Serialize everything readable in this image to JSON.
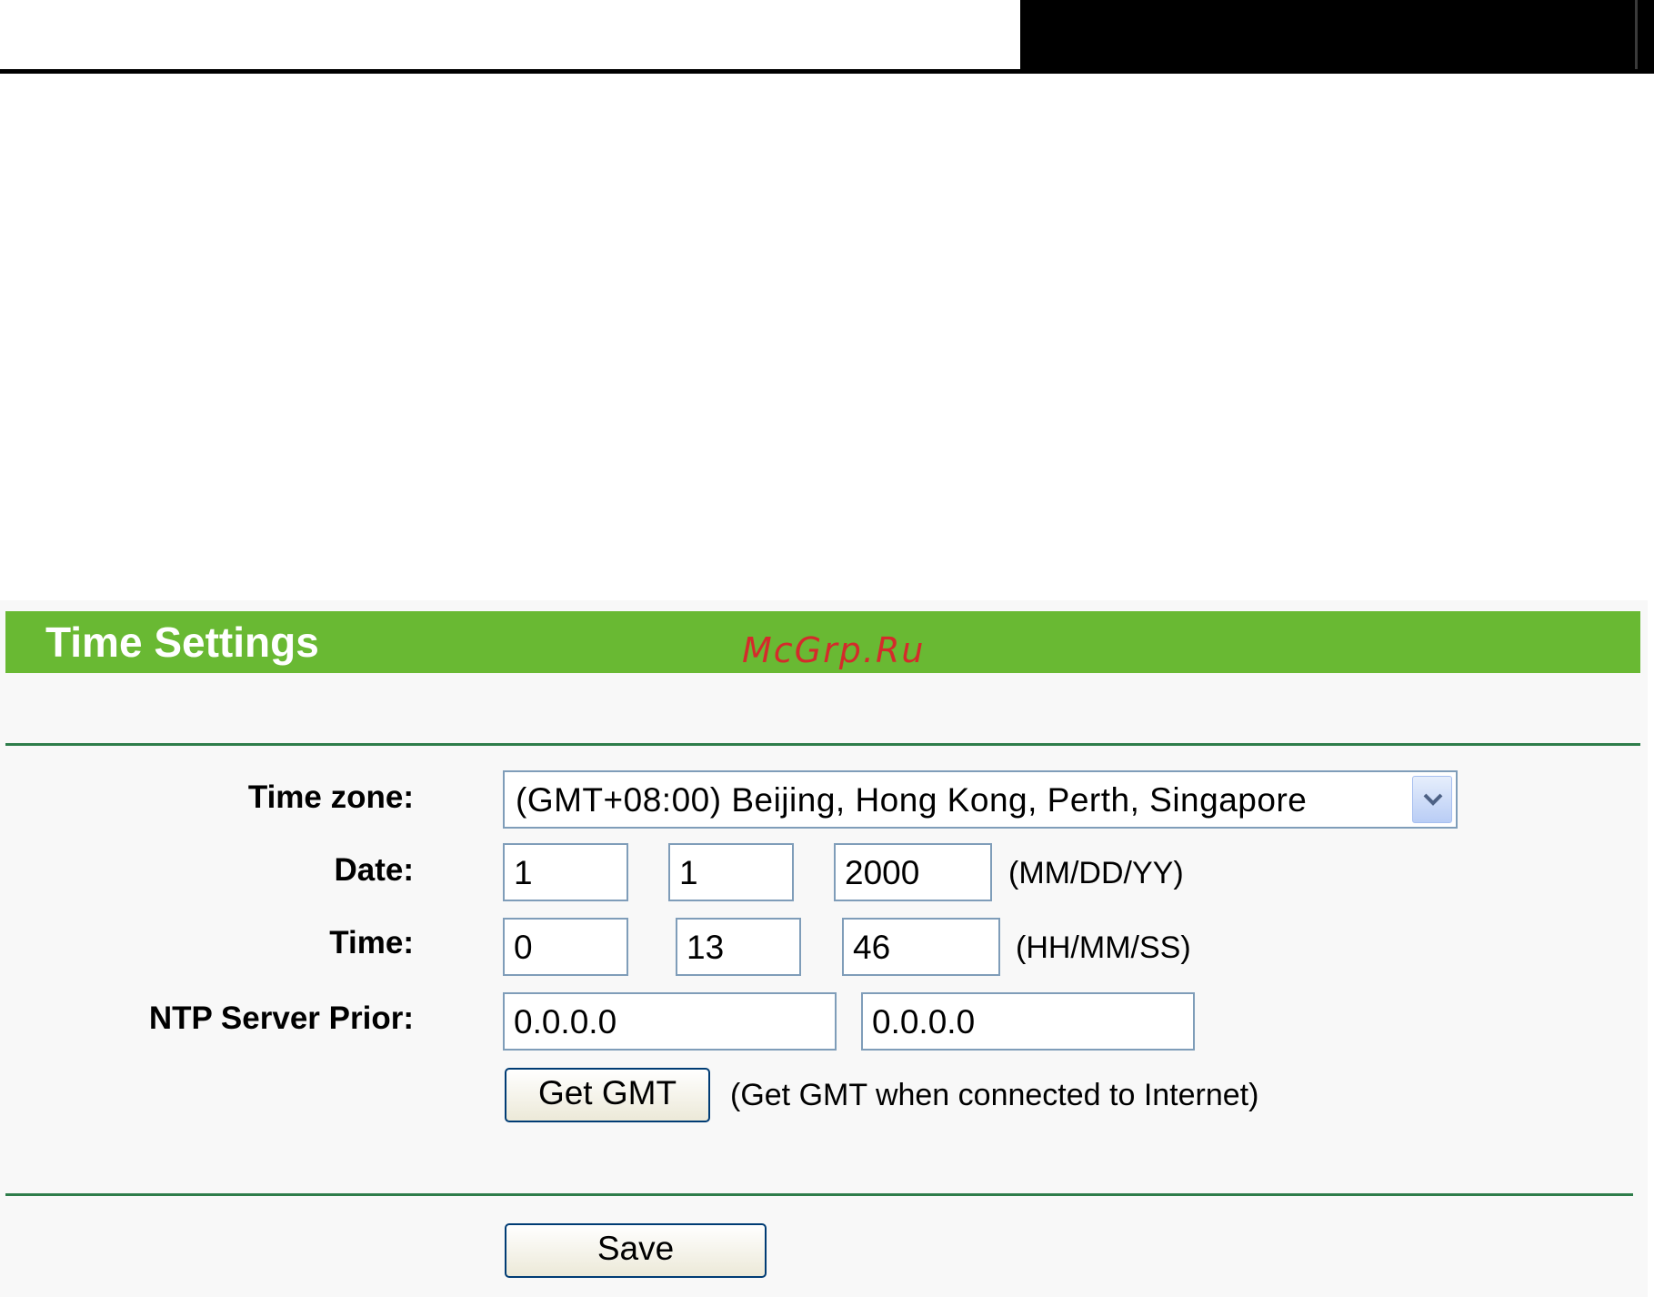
{
  "panel": {
    "title": "Time Settings",
    "watermark": "McGrp.Ru"
  },
  "form": {
    "timezone": {
      "label": "Time zone:",
      "value": "(GMT+08:00) Beijing, Hong Kong, Perth, Singapore"
    },
    "date": {
      "label": "Date:",
      "month": "1",
      "day": "1",
      "year": "2000",
      "format": "(MM/DD/YY)"
    },
    "time": {
      "label": "Time:",
      "hour": "0",
      "minute": "13",
      "second": "46",
      "format": "(HH/MM/SS)"
    },
    "ntp": {
      "label": "NTP Server Prior:",
      "primary": "0.0.0.0",
      "secondary": "0.0.0.0"
    },
    "get_gmt": {
      "button_label": "Get GMT",
      "note": "(Get GMT when connected to Internet)"
    },
    "save_label": "Save"
  },
  "colors": {
    "title_bar": "#69b933",
    "rule": "#2e7d4a",
    "watermark": "#d42b2b"
  }
}
